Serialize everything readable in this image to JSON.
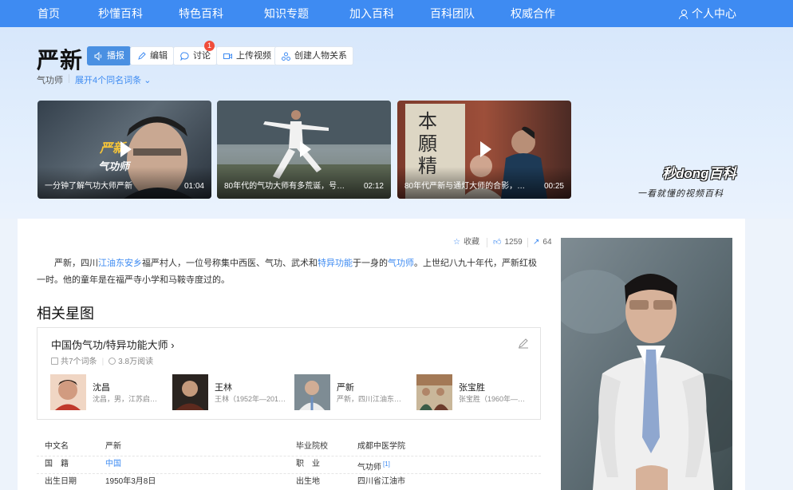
{
  "nav": {
    "items": [
      "首页",
      "秒懂百科",
      "特色百科",
      "知识专题",
      "加入百科",
      "百科团队",
      "权威合作"
    ],
    "user": "个人中心"
  },
  "entry": {
    "title": "严新",
    "subtitle": "气功师",
    "expand": "展开4个同名词条",
    "buttons": {
      "read": "播报",
      "edit": "编辑",
      "discuss": "讨论",
      "discuss_badge": "1",
      "upload": "上传视频",
      "relation": "创建人物关系"
    }
  },
  "videos": [
    {
      "title": "一分钟了解气功大师严新",
      "duration": "01:04",
      "overlay_name": "严新",
      "overlay_role": "气功师"
    },
    {
      "title": "80年代的气功大师有多荒诞，号称……",
      "duration": "02:12"
    },
    {
      "title": "80年代严新与通灯大师的合影，当……",
      "duration": "00:25"
    }
  ],
  "brand": {
    "logo": "秒dong百科",
    "slogan": "一看就懂的视频百科"
  },
  "actions": {
    "favorite": "收藏",
    "likes": "1259",
    "shares": "64"
  },
  "summary": {
    "p1": "严新，四川",
    "l1": "江油",
    "l2": "东安乡",
    "p2": "福严村人，一位号称集中西医、气功、武术和",
    "l3": "特异功能",
    "p3": "于一身的",
    "l4": "气功师",
    "p4": "。上世纪八九十年代，严新红极一时。他的童年是在福严寺小学和马鞍寺度过的。"
  },
  "starmap": {
    "heading": "相关星图",
    "title": "中国伪气功/特异功能大师",
    "count": "共7个词条",
    "reads": "3.8万阅读",
    "people": [
      {
        "name": "沈昌",
        "desc": "沈昌，男，江苏启东人……"
      },
      {
        "name": "王林",
        "desc": "王林（1952年—2017年）……"
      },
      {
        "name": "严新",
        "desc": "严新，四川江油东安乡……"
      },
      {
        "name": "张宝胜",
        "desc": "张宝胜（1960年—）……"
      }
    ]
  },
  "basic_info": [
    {
      "k1": "中文名",
      "v1": "严新",
      "k2": "毕业院校",
      "v2": "成都中医学院"
    },
    {
      "k1": "国　籍",
      "v1": "中国",
      "k2": "职　业",
      "v2": "气功师",
      "ref": "[1]"
    },
    {
      "k1": "出生日期",
      "v1": "1950年3月8日",
      "k2": "出生地",
      "v2": "四川省江油市"
    }
  ]
}
